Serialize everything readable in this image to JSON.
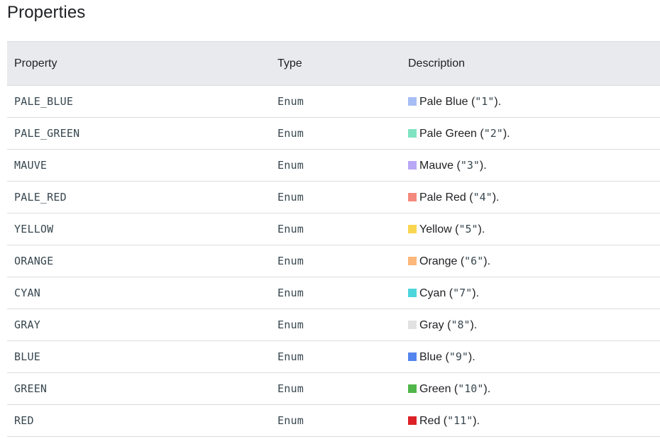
{
  "page": {
    "title": "Properties"
  },
  "table": {
    "headers": {
      "property": "Property",
      "type": "Type",
      "description": "Description"
    },
    "rows": [
      {
        "property": "PALE_BLUE",
        "type": "Enum",
        "color": "#a7bdf5",
        "name": "Pale Blue",
        "open": " (",
        "code": "\"1\"",
        "close": ")."
      },
      {
        "property": "PALE_GREEN",
        "type": "Enum",
        "color": "#7fe3c1",
        "name": "Pale Green",
        "open": " (",
        "code": "\"2\"",
        "close": ")."
      },
      {
        "property": "MAUVE",
        "type": "Enum",
        "color": "#b9a8f5",
        "name": "Mauve",
        "open": " (",
        "code": "\"3\"",
        "close": ")."
      },
      {
        "property": "PALE_RED",
        "type": "Enum",
        "color": "#f48a7d",
        "name": "Pale Red",
        "open": " (",
        "code": "\"4\"",
        "close": ")."
      },
      {
        "property": "YELLOW",
        "type": "Enum",
        "color": "#f9d64f",
        "name": "Yellow",
        "open": " (",
        "code": "\"5\"",
        "close": ")."
      },
      {
        "property": "ORANGE",
        "type": "Enum",
        "color": "#fcb77a",
        "name": "Orange",
        "open": " (",
        "code": "\"6\"",
        "close": ")."
      },
      {
        "property": "CYAN",
        "type": "Enum",
        "color": "#4cd6dc",
        "name": "Cyan",
        "open": " (",
        "code": "\"7\"",
        "close": ")."
      },
      {
        "property": "GRAY",
        "type": "Enum",
        "color": "#e1e1e1",
        "name": "Gray",
        "open": " (",
        "code": "\"8\"",
        "close": ")."
      },
      {
        "property": "BLUE",
        "type": "Enum",
        "color": "#5484ed",
        "name": "Blue",
        "open": " (",
        "code": "\"9\"",
        "close": ")."
      },
      {
        "property": "GREEN",
        "type": "Enum",
        "color": "#51b64a",
        "name": "Green",
        "open": " (",
        "code": "\"10\"",
        "close": ")."
      },
      {
        "property": "RED",
        "type": "Enum",
        "color": "#dc2127",
        "name": "Red",
        "open": " (",
        "code": "\"11\"",
        "close": ")."
      }
    ]
  }
}
